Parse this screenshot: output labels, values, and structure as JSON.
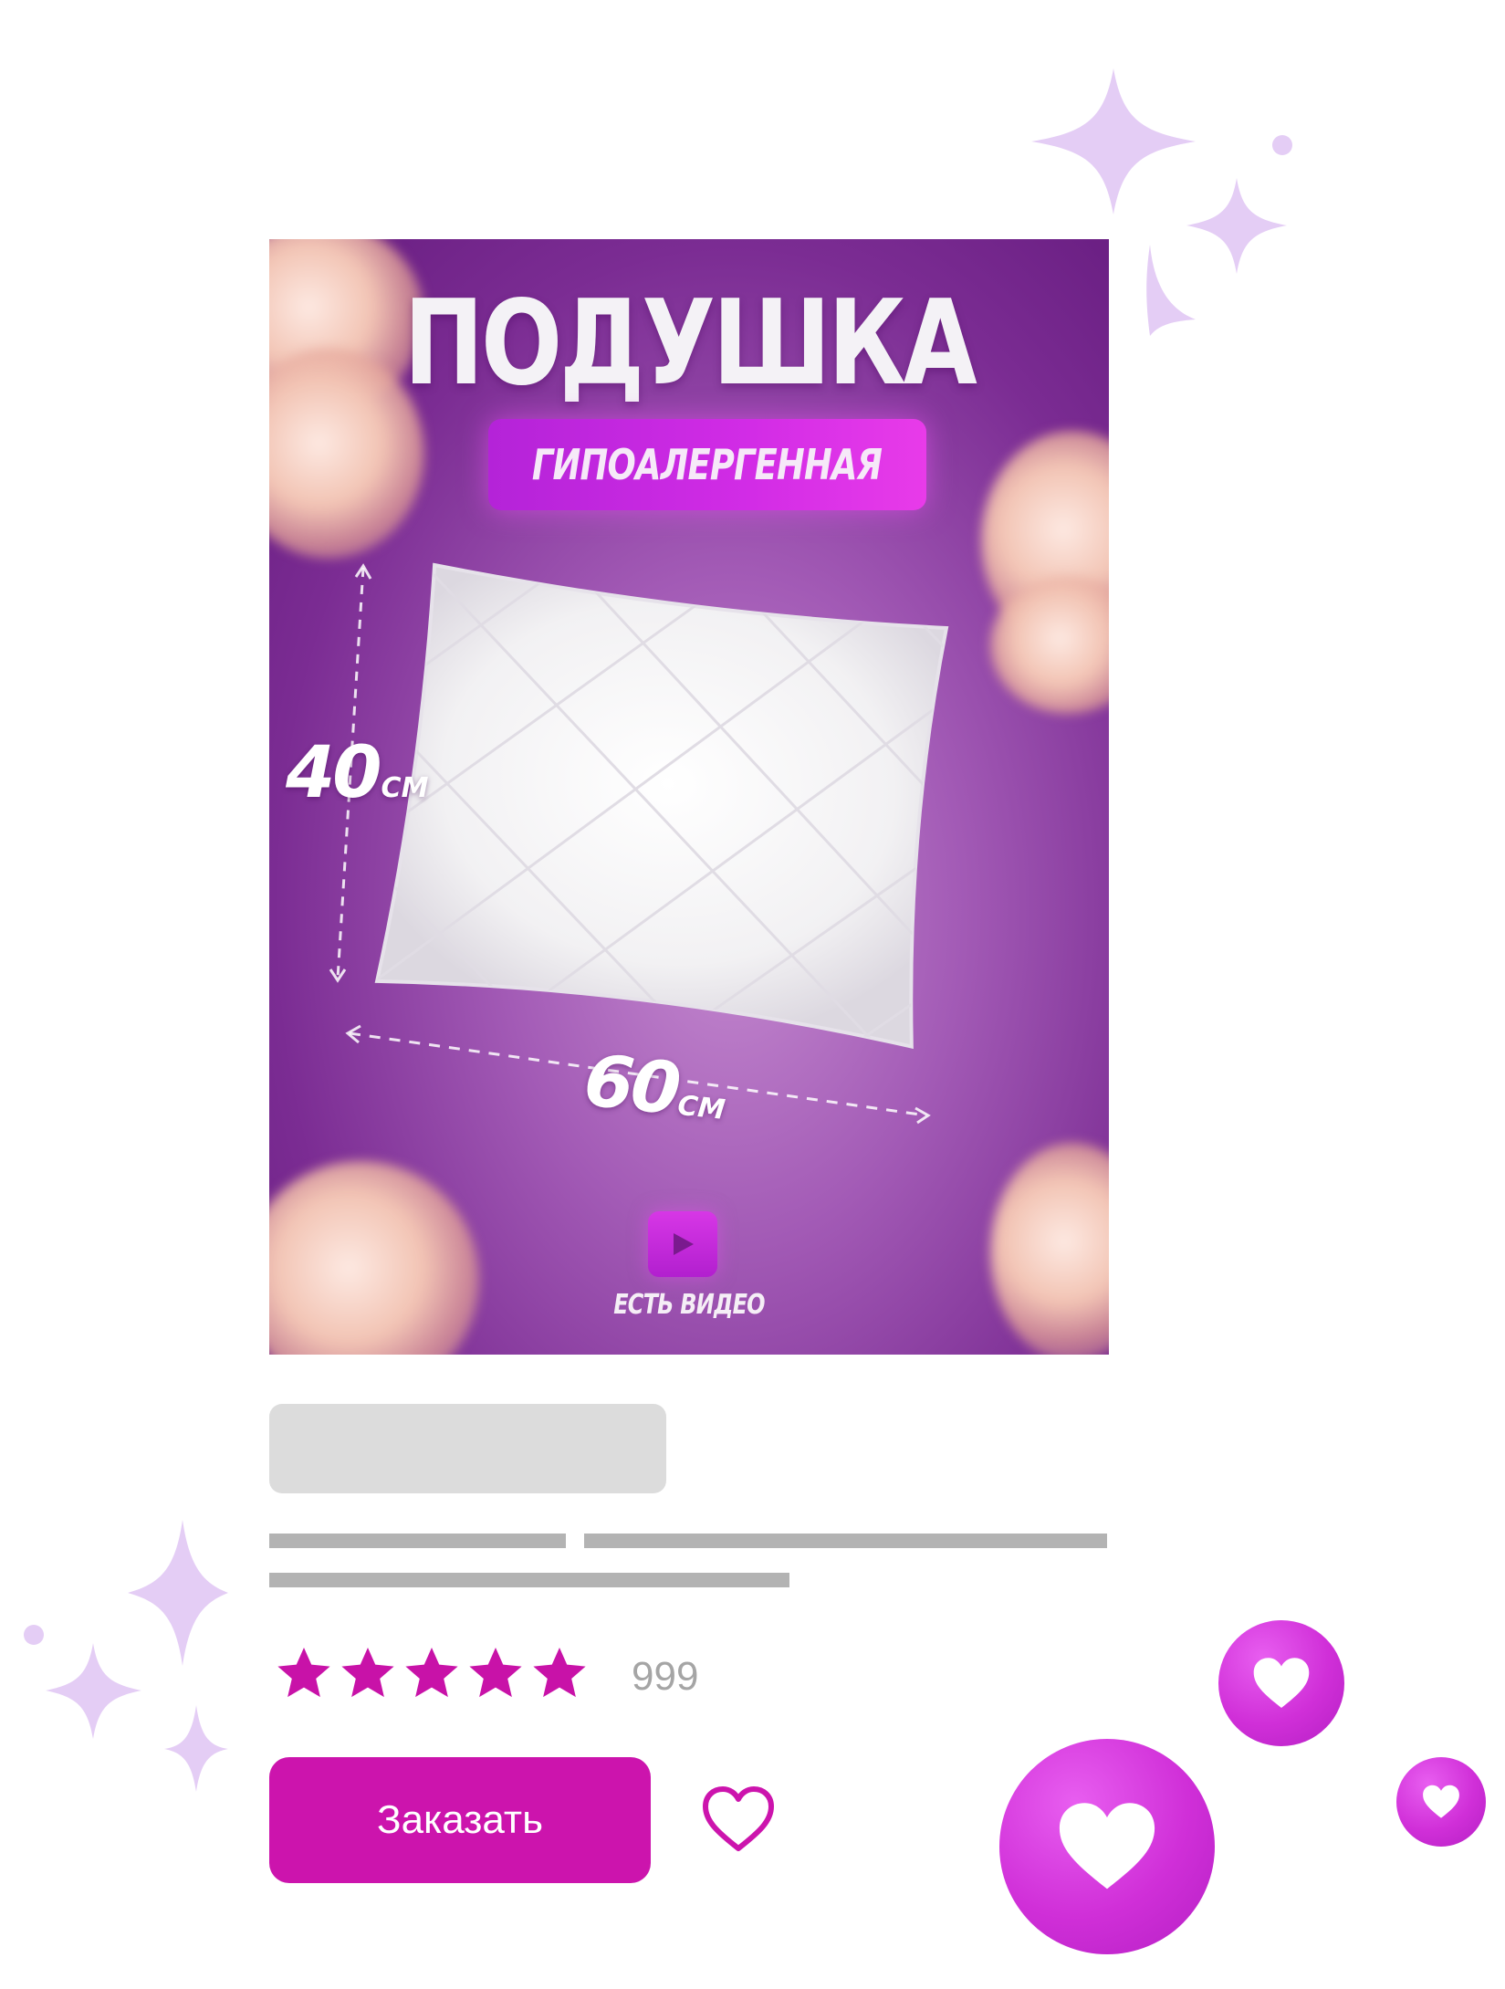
{
  "product": {
    "title": "ПОДУШКА",
    "badge": "ГИПОАЛЕРГЕННАЯ",
    "height_value": "40",
    "height_unit": "СМ",
    "width_value": "60",
    "width_unit": "СМ",
    "video_label": "ЕСТЬ ВИДЕО"
  },
  "rating": {
    "stars": 5,
    "count": "999",
    "star_color": "#c812a8"
  },
  "actions": {
    "order_label": "Заказать",
    "favorite_icon": "heart-outline-icon"
  },
  "colors": {
    "accent": "#cc14ad",
    "sparkle": "#e4cdf5",
    "bubble": "#d533dc"
  }
}
